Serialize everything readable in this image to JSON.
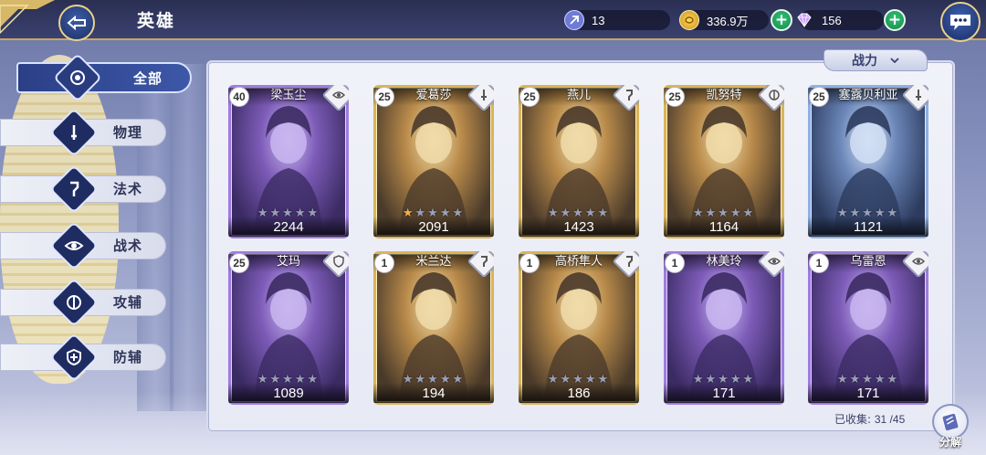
{
  "header": {
    "title": "英雄",
    "resources": [
      {
        "icon": "energy-crystal-icon",
        "value": "13"
      },
      {
        "icon": "gold-coin-icon",
        "value": "336.9万"
      },
      {
        "icon": "diamond-gem-icon",
        "value": "156"
      }
    ]
  },
  "tabs": [
    {
      "key": "all",
      "label": "全部",
      "icon": "all-circle-icon",
      "active": true
    },
    {
      "key": "physical",
      "label": "物理",
      "icon": "physical-sword-icon",
      "active": false
    },
    {
      "key": "magic",
      "label": "法术",
      "icon": "magic-staff-icon",
      "active": false
    },
    {
      "key": "tactics",
      "label": "战术",
      "icon": "tactics-eye-icon",
      "active": false
    },
    {
      "key": "support_attack",
      "label": "攻辅",
      "icon": "attack-support-icon",
      "active": false
    },
    {
      "key": "support_defense",
      "label": "防辅",
      "icon": "defense-shield-icon",
      "active": false
    }
  ],
  "sort": {
    "label": "战力"
  },
  "heroes": [
    {
      "name": "梁玉尘",
      "level": "40",
      "power": "2244",
      "stars": 0,
      "rarity": "purple",
      "class_icon": "tactics-eye-icon"
    },
    {
      "name": "爱葛莎",
      "level": "25",
      "power": "2091",
      "stars": 1,
      "rarity": "gold",
      "class_icon": "physical-sword-icon"
    },
    {
      "name": "燕儿",
      "level": "25",
      "power": "1423",
      "stars": 0,
      "rarity": "gold",
      "class_icon": "magic-staff-icon"
    },
    {
      "name": "凯努特",
      "level": "25",
      "power": "1164",
      "stars": 0,
      "rarity": "gold",
      "class_icon": "attack-support-icon"
    },
    {
      "name": "塞露贝利亚",
      "level": "25",
      "power": "1121",
      "stars": 0,
      "rarity": "blue",
      "class_icon": "physical-sword-icon"
    },
    {
      "name": "艾玛",
      "level": "25",
      "power": "1089",
      "stars": 0,
      "rarity": "purple",
      "class_icon": "defense-shield-icon"
    },
    {
      "name": "米兰达",
      "level": "1",
      "power": "194",
      "stars": 0,
      "rarity": "gold",
      "class_icon": "magic-staff-icon"
    },
    {
      "name": "高桥隼人",
      "level": "1",
      "power": "186",
      "stars": 0,
      "rarity": "gold",
      "class_icon": "magic-staff-icon"
    },
    {
      "name": "林美玲",
      "level": "1",
      "power": "171",
      "stars": 0,
      "rarity": "purple",
      "class_icon": "tactics-eye-icon"
    },
    {
      "name": "乌雷恩",
      "level": "1",
      "power": "171",
      "stars": 0,
      "rarity": "purple",
      "class_icon": "tactics-eye-icon"
    }
  ],
  "footer": {
    "collected_label": "已收集:",
    "collected_value": "31 /45",
    "decompose_label": "分解"
  },
  "colors": {
    "purple_frame": "#9f7ce0",
    "gold_frame": "#d9b45a",
    "blue_frame": "#8fb0e2",
    "accent_navy": "#2b3f86",
    "plus_green": "#1fa85f"
  }
}
